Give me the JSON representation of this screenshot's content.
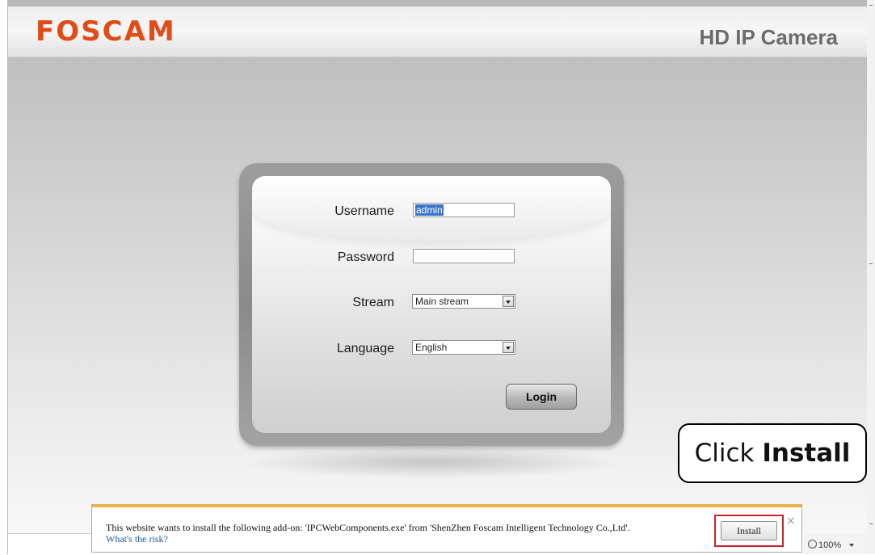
{
  "header": {
    "logo_text": "FOSCAM",
    "title": "HD IP Camera"
  },
  "login_form": {
    "username_label": "Username",
    "username_value": "admin",
    "password_label": "Password",
    "password_value": "",
    "stream_label": "Stream",
    "stream_selected": "Main stream",
    "language_label": "Language",
    "language_selected": "English",
    "login_button": "Login"
  },
  "callout": {
    "prefix": "Click ",
    "emphasis": "Install"
  },
  "notification_bar": {
    "message": "This website wants to install the following add-on: 'IPCWebComponents.exe' from 'ShenZhen Foscam Intelligent Technology Co.,Ltd'.",
    "risk_link": "What's the risk?",
    "install_button": "Install",
    "close_symbol": "×"
  },
  "status_bar": {
    "zoom": "100%"
  },
  "colors": {
    "brand": "#e04b16",
    "highlight_border": "#c3272b",
    "notification_accent": "#e8b24a",
    "selection": "#3b76c7"
  },
  "icons": [
    "zoom-icon",
    "dropdown-arrow-icon",
    "close-icon"
  ]
}
